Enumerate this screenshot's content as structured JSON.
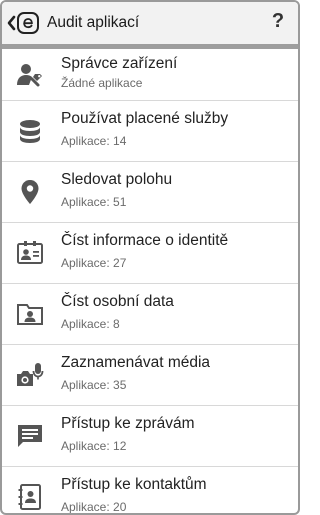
{
  "header": {
    "title": "Audit aplikací",
    "help_label": "?"
  },
  "colors": {
    "appbar_bg": "#f2f2f2",
    "divider": "#9e9e9e",
    "icon": "#555555"
  },
  "items": [
    {
      "icon": "device-admin-icon",
      "title": "Správce zařízení",
      "subtitle": "Žádné aplikace"
    },
    {
      "icon": "coins-icon",
      "title": "Používat placené služby",
      "subtitle": "Aplikace: 14"
    },
    {
      "icon": "location-pin-icon",
      "title": "Sledovat polohu",
      "subtitle": "Aplikace: 51"
    },
    {
      "icon": "id-card-icon",
      "title": "Číst informace o identitě",
      "subtitle": "Aplikace: 27"
    },
    {
      "icon": "personal-folder-icon",
      "title": "Číst osobní data",
      "subtitle": "Aplikace: 8"
    },
    {
      "icon": "camera-mic-icon",
      "title": "Zaznamenávat média",
      "subtitle": "Aplikace: 35"
    },
    {
      "icon": "message-icon",
      "title": "Přístup ke zprávám",
      "subtitle": "Aplikace: 12"
    },
    {
      "icon": "contacts-icon",
      "title": "Přístup ke kontaktům",
      "subtitle": "Aplikace: 20"
    }
  ]
}
